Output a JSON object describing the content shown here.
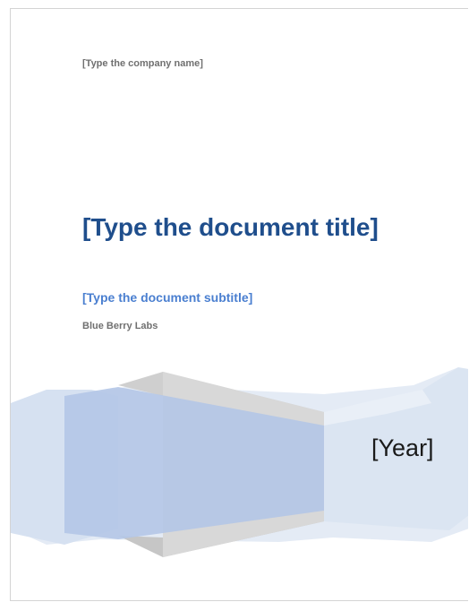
{
  "cover": {
    "company": "[Type the company name]",
    "title": "[Type the document title]",
    "subtitle": "[Type the document subtitle]",
    "author": "Blue Berry Labs",
    "year": "[Year]"
  },
  "colors": {
    "title": "#1f4e8c",
    "subtitle": "#4a7fd0",
    "meta_text": "#707070",
    "band_blue": "#b7c9e6",
    "band_blue_dark": "#a9bde0",
    "band_gray": "#c8c8c8",
    "band_light": "#dce6f2"
  }
}
